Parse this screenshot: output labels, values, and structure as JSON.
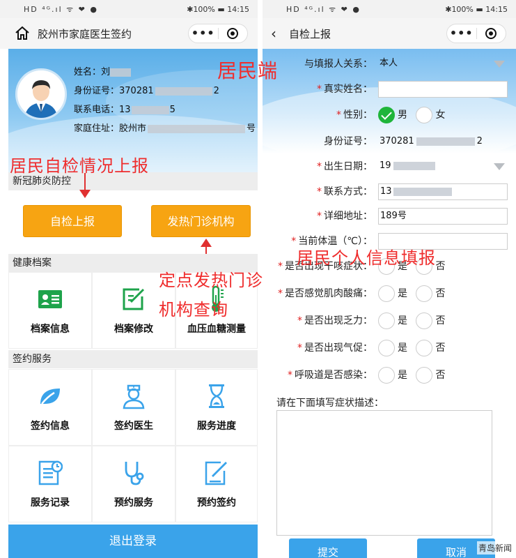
{
  "status": {
    "time": "14:15",
    "battery": "100%",
    "left_icons": "HD ⁴ᴳ.ıl ᯤ ❤ ●"
  },
  "left": {
    "nav_title": "胶州市家庭医生签约",
    "profile": {
      "name_label": "姓名：",
      "name_value": "刘",
      "id_label": "身份证号：",
      "id_prefix": "370281",
      "id_suffix": "2",
      "phone_label": "联系电话：",
      "phone_prefix": "13",
      "phone_suffix": "5",
      "addr_label": "家庭住址：",
      "addr_prefix": "胶州市",
      "addr_suffix": "号"
    },
    "section_covid": "新冠肺炎防控",
    "btn_self_check": "自检上报",
    "btn_fever_clinic": "发热门诊机构",
    "section_health": "健康档案",
    "health_items": [
      {
        "label": "档案信息",
        "icon": "id-card-icon"
      },
      {
        "label": "档案修改",
        "icon": "edit-note-icon"
      },
      {
        "label": "血压血糖测量",
        "icon": "thermometer-icon"
      }
    ],
    "section_sign": "签约服务",
    "sign_items": [
      {
        "label": "签约信息",
        "icon": "leaf-icon"
      },
      {
        "label": "签约医生",
        "icon": "doctor-icon"
      },
      {
        "label": "服务进度",
        "icon": "hourglass-icon"
      },
      {
        "label": "服务记录",
        "icon": "document-clock-icon"
      },
      {
        "label": "预约服务",
        "icon": "stethoscope-icon"
      },
      {
        "label": "预约签约",
        "icon": "sign-edit-icon"
      }
    ],
    "logout": "退出登录"
  },
  "annotations": {
    "resident_end": "居民端",
    "self_report": "居民自检情况上报",
    "fever_query_1": "定点发热门诊",
    "fever_query_2": "机构查询",
    "personal_info": "居民个人信息填报"
  },
  "right": {
    "nav_title": "自检上报",
    "fields": {
      "relation_label": "与填报人关系：",
      "relation_value": "本人",
      "name_label": "真实姓名：",
      "name_value": "",
      "gender_label": "性别：",
      "gender_male": "男",
      "gender_female": "女",
      "id_label": "身份证号：",
      "id_prefix": "370281",
      "id_suffix": "2",
      "birth_label": "出生日期：",
      "birth_value": "19",
      "contact_label": "联系方式：",
      "contact_value": "13",
      "address_label": "详细地址：",
      "address_value": "189号",
      "temp_label": "当前体温（℃）：",
      "temp_value": "",
      "cough_label": "是否出现干咳症状：",
      "muscle_label": "是否感觉肌肉酸痛：",
      "fatigue_label": "是否出现乏力：",
      "breath_label": "是否出现气促：",
      "resp_label": "呼吸道是否感染："
    },
    "yes": "是",
    "no": "否",
    "desc_label": "请在下面填写症状描述：",
    "submit": "提交",
    "cancel": "取消",
    "watermark": "青岛新闻"
  },
  "colors": {
    "orange": "#f7a412",
    "blue": "#3aa3ea",
    "green": "#1fb53a",
    "annotation_red": "#ef2d2d"
  }
}
